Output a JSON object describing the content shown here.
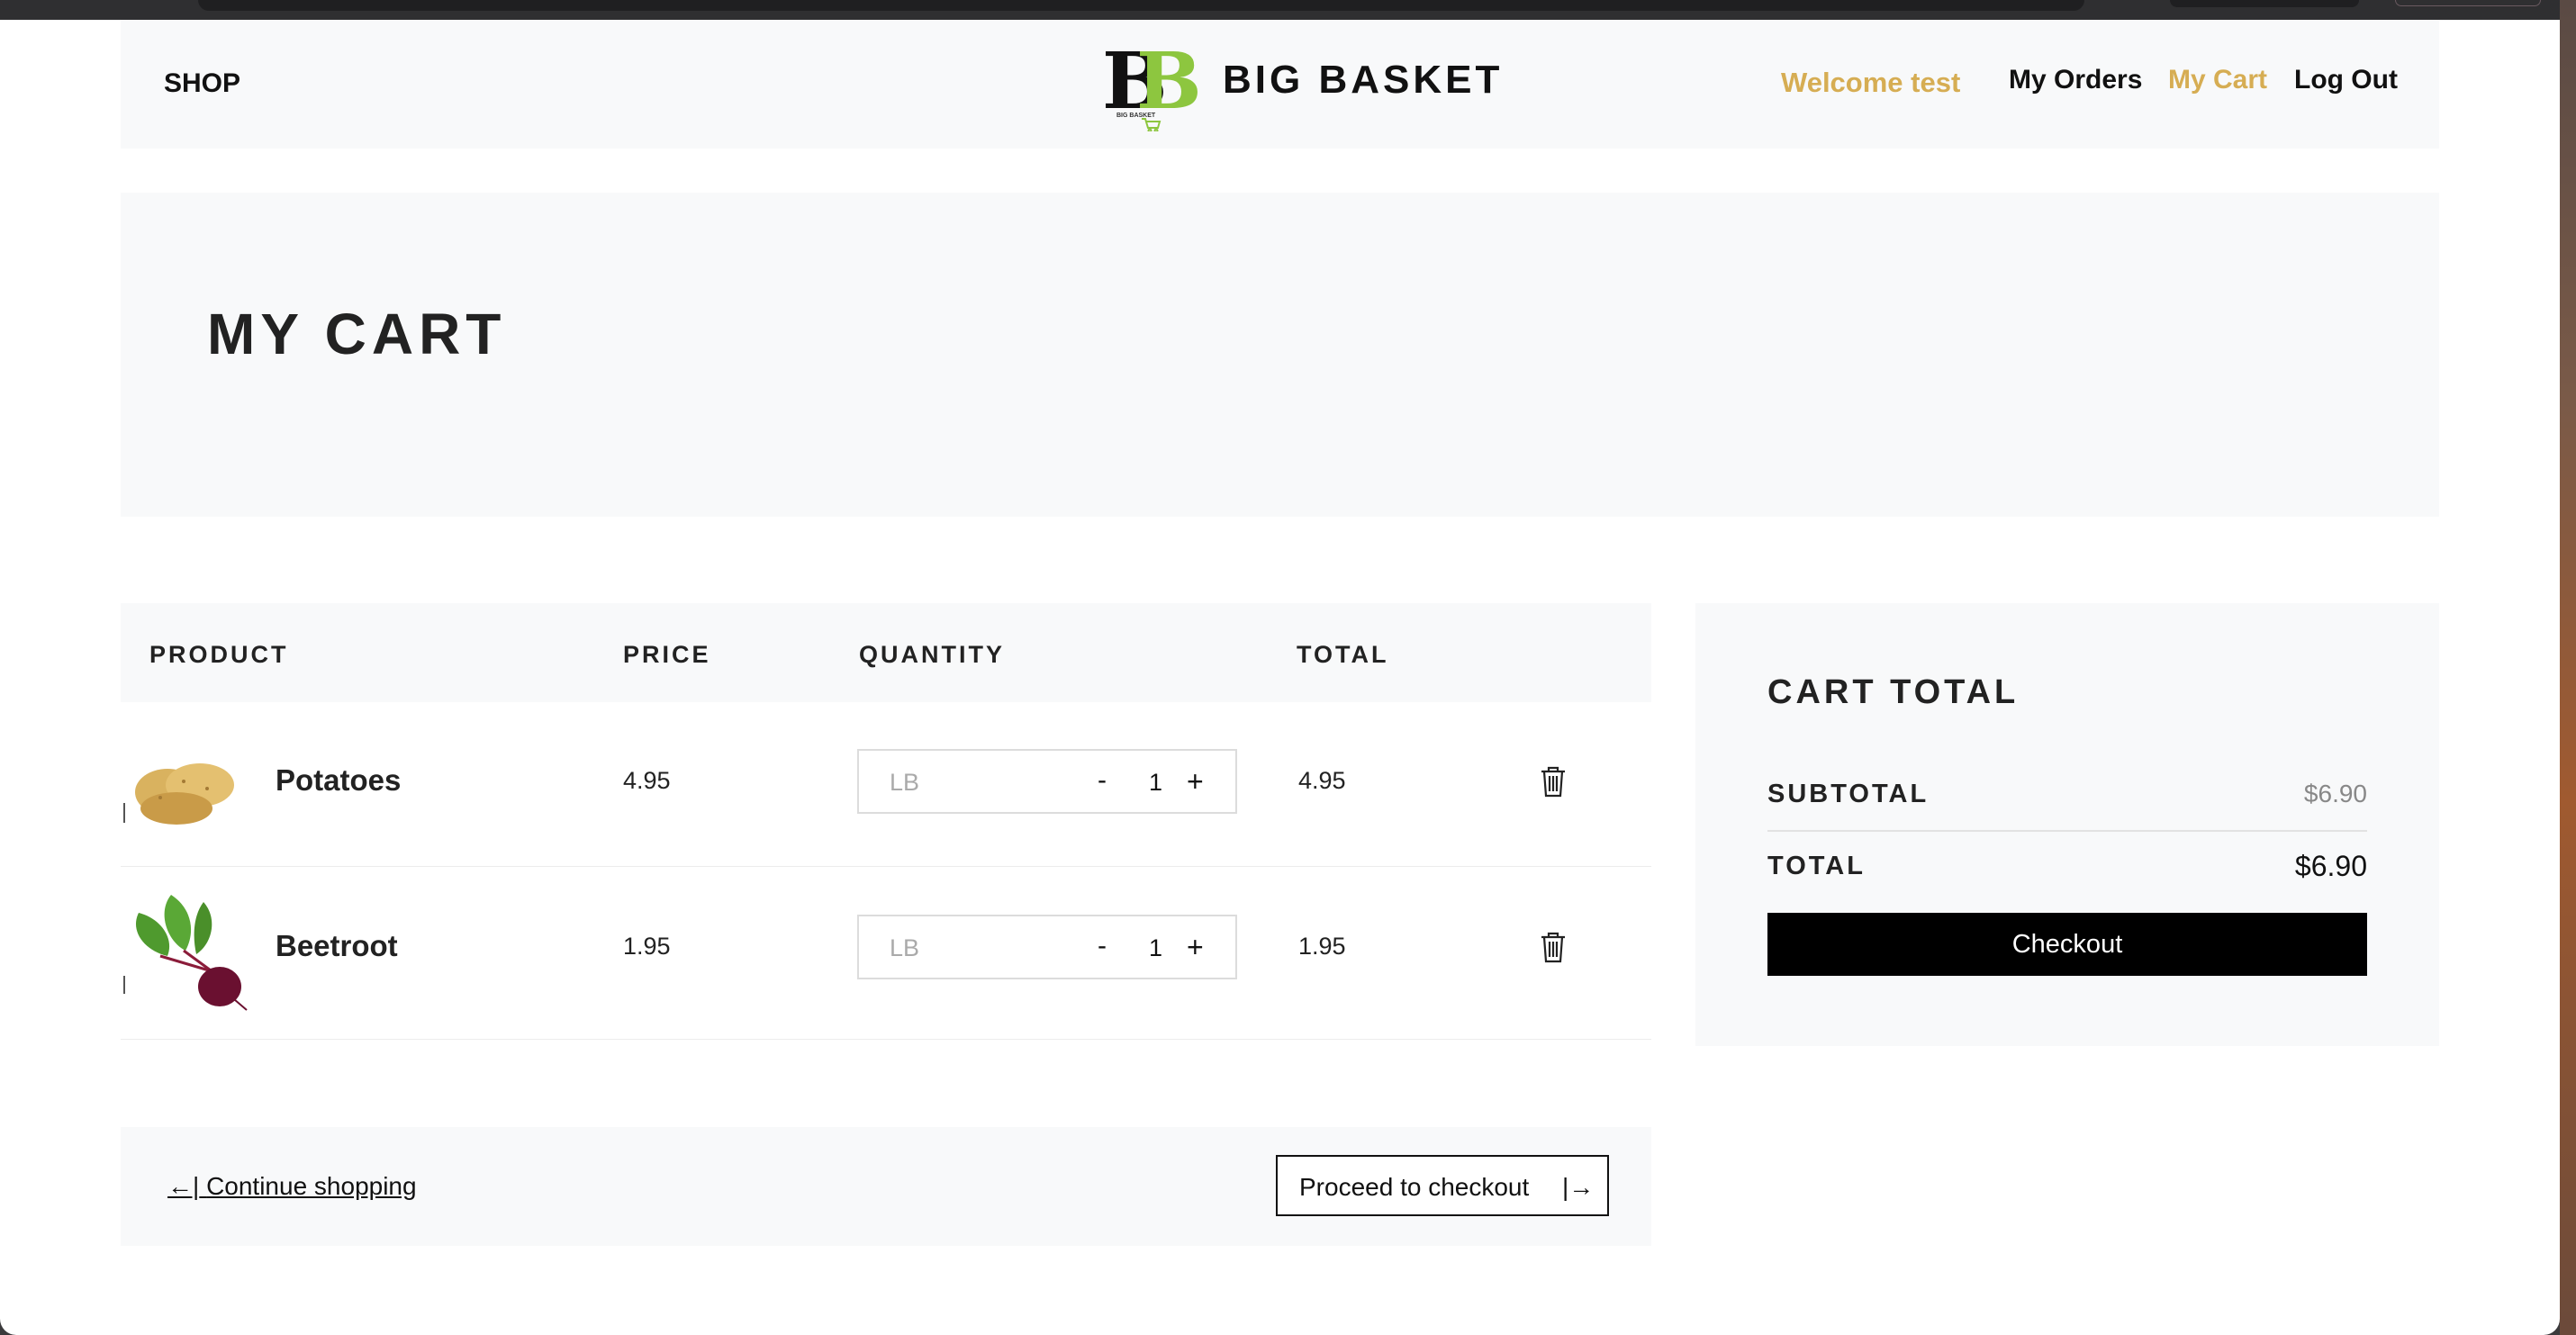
{
  "header": {
    "shop_label": "SHOP",
    "logo_small_text": "BIG BASKET",
    "brand": "BIG BASKET",
    "welcome": "Welcome test",
    "nav": {
      "my_orders": "My Orders",
      "my_cart": "My Cart",
      "log_out": "Log Out"
    }
  },
  "hero": {
    "title": "MY CART"
  },
  "table": {
    "headers": {
      "product": "PRODUCT",
      "price": "PRICE",
      "quantity": "QUANTITY",
      "total": "TOTAL"
    },
    "rows": [
      {
        "name": "Potatoes",
        "price": "4.95",
        "unit": "LB",
        "minus": "-",
        "qty": "1",
        "plus": "+",
        "total": "4.95"
      },
      {
        "name": "Beetroot",
        "price": "1.95",
        "unit": "LB",
        "minus": "-",
        "qty": "1",
        "plus": "+",
        "total": "1.95"
      }
    ]
  },
  "footer": {
    "continue_arrow": "←|",
    "continue": "Continue shopping",
    "proceed": "Proceed to checkout",
    "proceed_arrow": "|→"
  },
  "summary": {
    "title": "CART TOTAL",
    "subtotal_label": "SUBTOTAL",
    "subtotal_value": "$6.90",
    "total_label": "TOTAL",
    "total_value": "$6.90",
    "checkout": "Checkout"
  },
  "colors": {
    "accent": "#d6ad53",
    "panel": "#f8f9fa",
    "brand_green": "#8dc63f"
  },
  "icons": [
    "trash-icon",
    "potato-image",
    "beetroot-image",
    "cart-logo-icon"
  ]
}
